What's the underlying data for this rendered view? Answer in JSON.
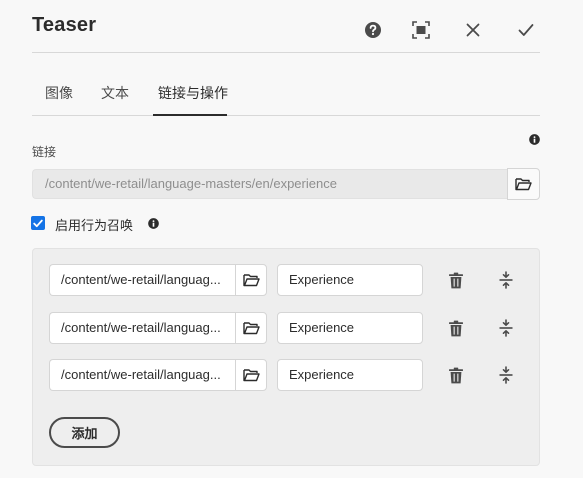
{
  "dialog": {
    "title": "Teaser"
  },
  "header_actions": {
    "help_icon": "help-circle-icon",
    "fullscreen_icon": "fullscreen-icon",
    "cancel_icon": "close-icon",
    "done_icon": "checkmark-icon"
  },
  "tabs": [
    {
      "label": "图像",
      "active": false
    },
    {
      "label": "文本",
      "active": false
    },
    {
      "label": "链接与操作",
      "active": true
    }
  ],
  "link_field": {
    "label": "链接",
    "placeholder": "/content/we-retail/language-masters/en/experience",
    "value": ""
  },
  "cta_toggle": {
    "label": "启用行为召唤",
    "checked": true
  },
  "actions": [
    {
      "link": "/content/we-retail/languag...",
      "text": "Experience"
    },
    {
      "link": "/content/we-retail/languag...",
      "text": "Experience"
    },
    {
      "link": "/content/we-retail/languag...",
      "text": "Experience"
    }
  ],
  "add_button": {
    "label": "添加"
  },
  "colors": {
    "accent": "#1473e6",
    "text": "#2c2c2c",
    "panel": "#eeeeee",
    "background": "#f8f8f8"
  }
}
